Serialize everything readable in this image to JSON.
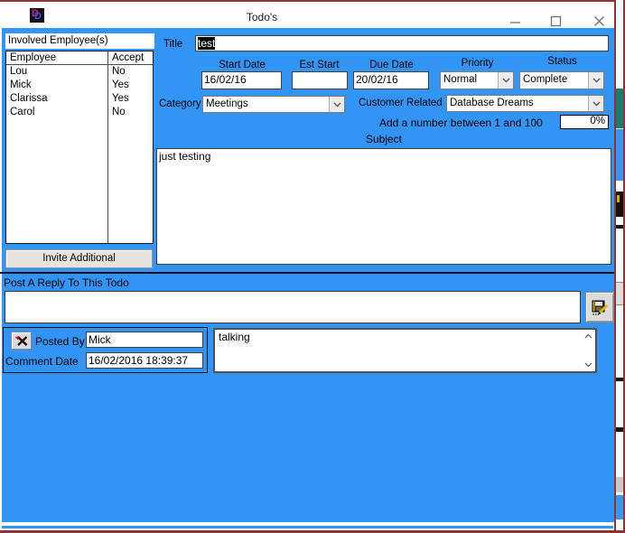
{
  "window": {
    "title": "Todo's",
    "icon": "overlapping-d-logo",
    "controls": {
      "minimize": "minimize-icon",
      "maximize": "maximize-icon",
      "close": "close-icon"
    }
  },
  "colors": {
    "form_background": "#3294f4",
    "window_border": "#8e3434",
    "selection_background": "#000000",
    "selection_text": "#ffffff"
  },
  "employees": {
    "section_label": "Involved Employee(s)",
    "columns": {
      "employee": "Employee",
      "accept": "Accept"
    },
    "rows": [
      {
        "employee": "Lou",
        "accept": "No"
      },
      {
        "employee": "Mick",
        "accept": "Yes"
      },
      {
        "employee": "Clarissa",
        "accept": "Yes"
      },
      {
        "employee": "Carol",
        "accept": "No"
      }
    ],
    "invite_button_label": "Invite Additional"
  },
  "todo": {
    "title_label": "Title",
    "title_value": "test",
    "start_date_label": "Start Date",
    "start_date_value": "16/02/16",
    "est_start_label": "Est Start",
    "est_start_value": "",
    "due_date_label": "Due Date",
    "due_date_value": "20/02/16",
    "priority_label": "Priority",
    "priority_value": "Normal",
    "status_label": "Status",
    "status_value": "Complete",
    "category_label": "Category",
    "category_value": "Meetings",
    "customer_related_label": "Customer Related",
    "customer_related_value": "Database Dreams",
    "percent_hint_label": "Add a number between 1 and 100",
    "percent_value": "0%",
    "subject_label": "Subject",
    "subject_value": "just testing"
  },
  "reply": {
    "section_label": "Post A Reply To This Todo",
    "input_value": "",
    "save_button_icon": "save-edit-icon"
  },
  "comment": {
    "delete_icon": "delete-record-icon",
    "posted_by_label": "Posted By",
    "posted_by_value": "Mick",
    "comment_date_label": "Comment Date",
    "comment_date_value": "16/02/2016 18:39:37",
    "text_value": "talking"
  }
}
